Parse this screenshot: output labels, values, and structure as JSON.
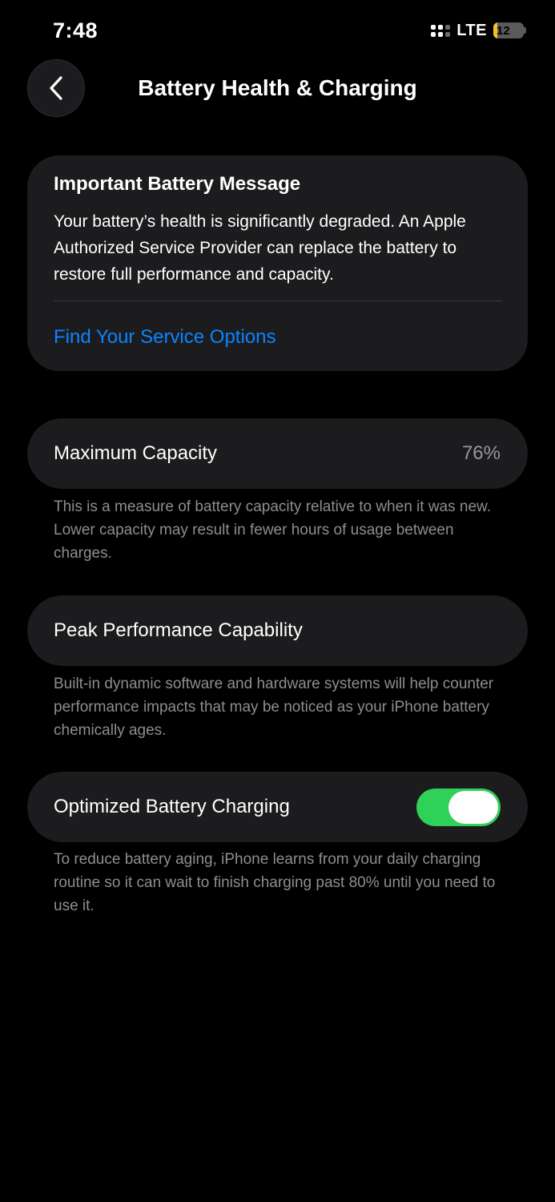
{
  "status_bar": {
    "time": "7:48",
    "network": "LTE",
    "battery_level": "12",
    "battery_fraction": 0.12,
    "battery_color": "#f4c12b"
  },
  "nav": {
    "back_icon": "chevron-left-icon",
    "title": "Battery Health & Charging"
  },
  "message_card": {
    "title": "Important Battery Message",
    "body": "Your battery’s health is significantly degraded. An Apple Authorized Service Provider can replace the battery to restore full performance and capacity.",
    "link": "Find Your Service Options",
    "link_color": "#0a84ff"
  },
  "maximum_capacity": {
    "label": "Maximum Capacity",
    "value": "76%",
    "footnote": "This is a measure of battery capacity relative to when it was new. Lower capacity may result in fewer hours of usage between charges."
  },
  "peak_performance": {
    "label": "Peak Performance Capability",
    "footnote": "Built-in dynamic software and hardware systems will help counter performance impacts that may be noticed as your iPhone battery chemically ages."
  },
  "optimized_charging": {
    "label": "Optimized Battery Charging",
    "enabled": true,
    "toggle_color": "#30d158",
    "footnote": "To reduce battery aging, iPhone learns from your daily charging routine so it can wait to finish charging past 80% until you need to use it."
  }
}
